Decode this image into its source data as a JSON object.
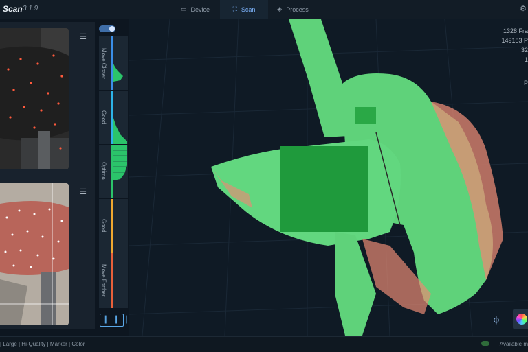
{
  "app": {
    "title": "Scan",
    "version": "3.1.9"
  },
  "tabs": [
    {
      "label": "Device",
      "icon": "device-icon",
      "active": false
    },
    {
      "label": "Scan",
      "icon": "scan-icon",
      "active": true
    },
    {
      "label": "Process",
      "icon": "layers-icon",
      "active": false
    }
  ],
  "distance_guide": {
    "segments": [
      {
        "label": "Move Closer",
        "color": "#3a8ee8"
      },
      {
        "label": "Good",
        "color": "#2db3e8"
      },
      {
        "label": "Optimal",
        "color": "#2bc46a"
      },
      {
        "label": "Good",
        "color": "#f0a830"
      },
      {
        "label": "Move Farther",
        "color": "#e8603a"
      }
    ]
  },
  "stats": {
    "frames": "1328 Fra",
    "points": "149183 P",
    "line3": "32",
    "line4": "1",
    "line5": "P"
  },
  "status": {
    "mode": "| Large | Hi-Quality | Marker | Color",
    "available": "Available m"
  },
  "colors": {
    "accent": "#4a8fe0",
    "optimal": "#2bc46a",
    "mesh": "#5fd27a"
  }
}
